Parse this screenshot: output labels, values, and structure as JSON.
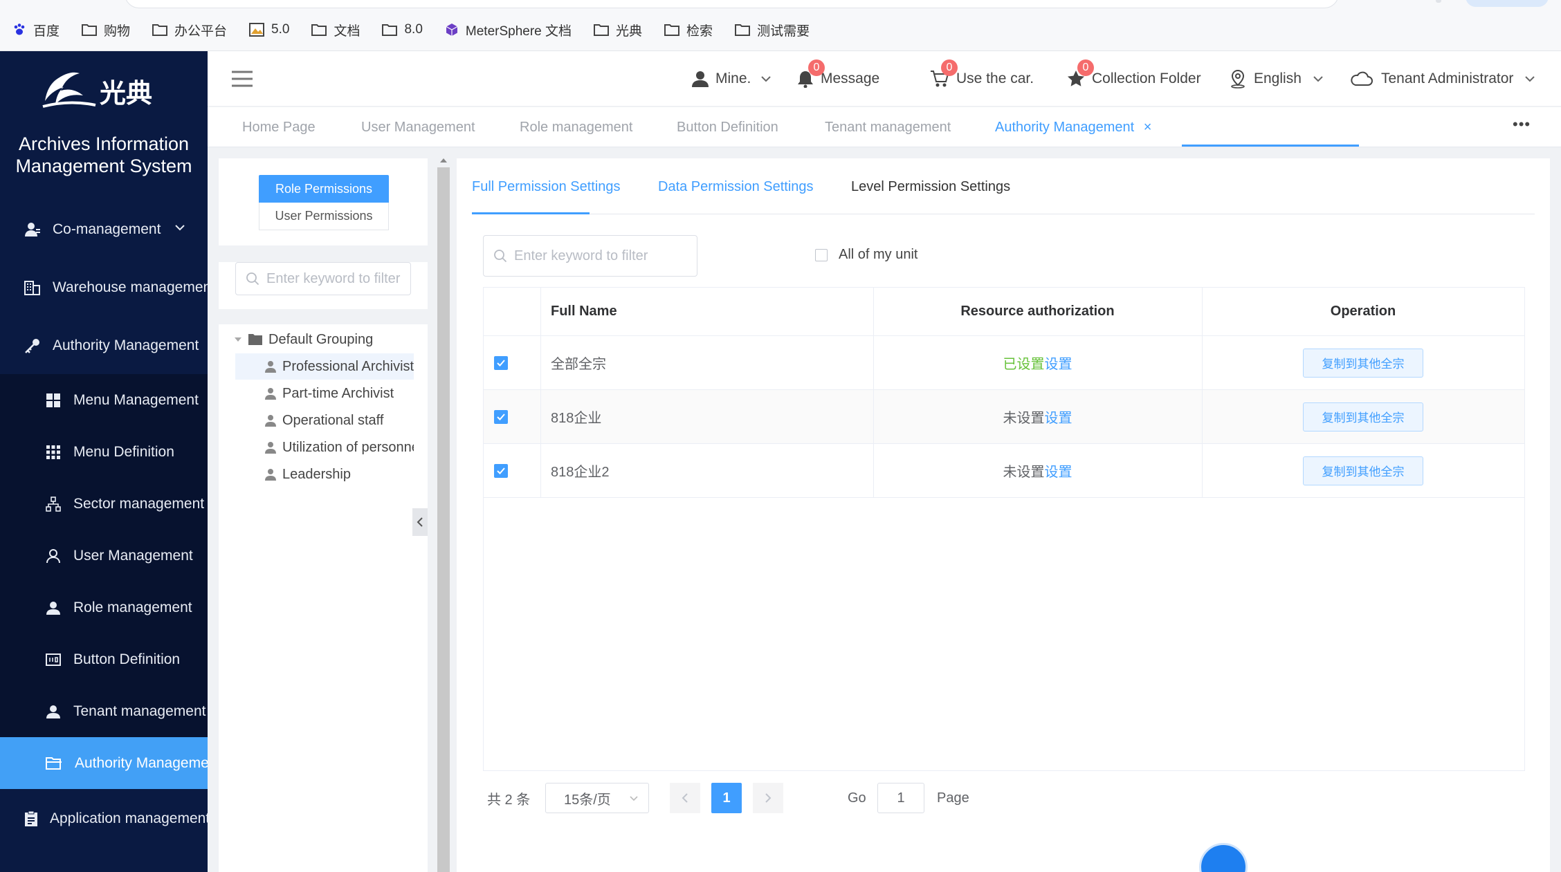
{
  "bookmarks": [
    "百度",
    "购物",
    "办公平台",
    "5.0",
    "文档",
    "8.0",
    "MeterSphere 文档",
    "光典",
    "检索",
    "测试需要"
  ],
  "brand": {
    "logo_text": "光典",
    "system_title_line1": "Archives Information",
    "system_title_line2": "Management System"
  },
  "sidebar": {
    "items": [
      {
        "label": "Co-management",
        "icon": "user-group-icon"
      },
      {
        "label": "Warehouse management",
        "icon": "building-icon"
      },
      {
        "label": "Authority Management",
        "icon": "key-icon"
      },
      {
        "label": "Menu Management",
        "icon": "grid-icon"
      },
      {
        "label": "Menu Definition",
        "icon": "grid-nine-icon"
      },
      {
        "label": "Sector management",
        "icon": "sitemap-icon"
      },
      {
        "label": "User Management",
        "icon": "user-outline-icon"
      },
      {
        "label": "Role management",
        "icon": "user-filled-icon"
      },
      {
        "label": "Button Definition",
        "icon": "button-icon"
      },
      {
        "label": "Tenant management",
        "icon": "user-filled-icon"
      },
      {
        "label": "Authority Management",
        "icon": "folder-open-icon"
      },
      {
        "label": "Application management",
        "icon": "clipboard-icon"
      }
    ]
  },
  "header": {
    "mine": "Mine.",
    "message": "Message",
    "message_badge": "0",
    "cart": "Use the car.",
    "cart_badge": "0",
    "collection": "Collection Folder",
    "collection_badge": "0",
    "language": "English",
    "tenant": "Tenant Administrator"
  },
  "tabs": [
    "Home Page",
    "User Management",
    "Role management",
    "Button Definition",
    "Tenant management",
    "Authority Management"
  ],
  "tabs_close": "×",
  "tabs_more": "•••",
  "left_panel": {
    "role_permissions": "Role Permissions",
    "user_permissions": "User Permissions",
    "search_placeholder": "Enter keyword to filter",
    "tree_root": "Default Grouping",
    "tree_items": [
      "Professional Archivist",
      "Part-time Archivist",
      "Operational staff",
      "Utilization of personnel",
      "Leadership"
    ]
  },
  "right_panel": {
    "tabs": [
      "Full Permission Settings",
      "Data Permission Settings",
      "Level Permission Settings"
    ],
    "filter_placeholder": "Enter keyword to filter",
    "all_of_unit": "All of my unit",
    "columns": [
      "Full Name",
      "Resource authorization",
      "Operation"
    ],
    "rows": [
      {
        "name": "全部全宗",
        "status": "已设置",
        "link": "设置",
        "status_type": "set",
        "action": "复制到其他全宗",
        "checked": true
      },
      {
        "name": "818企业",
        "status": "未设置",
        "link": "设置",
        "status_type": "unset",
        "action": "复制到其他全宗",
        "checked": true
      },
      {
        "name": "818企业2",
        "status": "未设置",
        "link": "设置",
        "status_type": "unset",
        "action": "复制到其他全宗",
        "checked": true
      }
    ],
    "pagination": {
      "total": "共 2 条",
      "page_size": "15条/页",
      "current_page": "1",
      "go_label": "Go",
      "go_value": "1",
      "page_label": "Page"
    }
  },
  "colors": {
    "primary": "#409eff",
    "sidebar_bg": "#0a1a42",
    "sidebar_active": "#42a0f6",
    "success": "#67c23a",
    "badge": "#f56c6c"
  }
}
